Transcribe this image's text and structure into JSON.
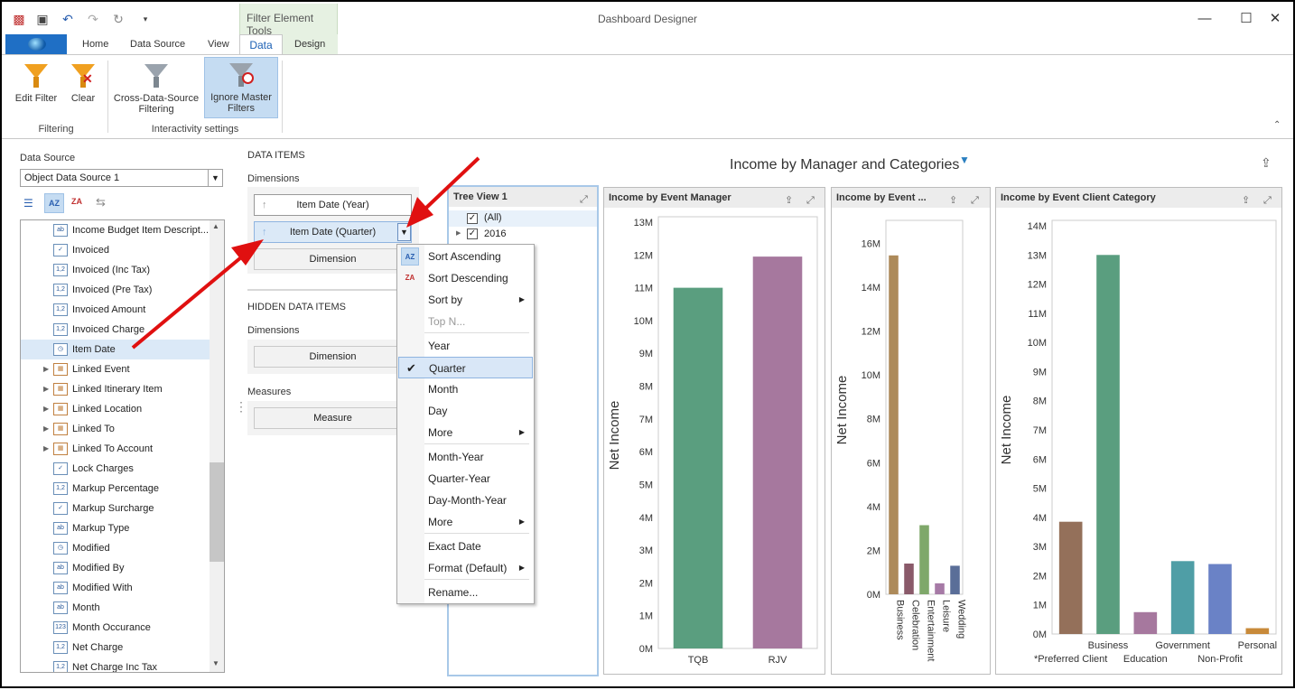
{
  "window": {
    "title": "Dashboard Designer",
    "context_tab_group": "Filter Element Tools"
  },
  "tabs": [
    "Home",
    "Data Source",
    "View",
    "Data",
    "Design"
  ],
  "ribbon": {
    "filtering": {
      "edit_filter": "Edit Filter",
      "clear": "Clear",
      "group": "Filtering"
    },
    "interactivity": {
      "cross_line1": "Cross-Data-Source",
      "cross_line2": "Filtering",
      "ignore_line1": "Ignore Master",
      "ignore_line2": "Filters",
      "group": "Interactivity settings"
    }
  },
  "data_source": {
    "label": "Data Source",
    "value": "Object Data Source 1"
  },
  "fields": [
    {
      "label": "Income Budget Item Descript...",
      "icon": "ab"
    },
    {
      "label": "Invoiced",
      "icon": "check"
    },
    {
      "label": "Invoiced (Inc Tax)",
      "icon": "1,2"
    },
    {
      "label": "Invoiced (Pre Tax)",
      "icon": "1,2"
    },
    {
      "label": "Invoiced Amount",
      "icon": "1,2"
    },
    {
      "label": "Invoiced Charge",
      "icon": "1,2"
    },
    {
      "label": "Item Date",
      "icon": "clock"
    },
    {
      "label": "Linked Event",
      "icon": "table"
    },
    {
      "label": "Linked Itinerary Item",
      "icon": "table"
    },
    {
      "label": "Linked Location",
      "icon": "table"
    },
    {
      "label": "Linked To",
      "icon": "table"
    },
    {
      "label": "Linked To Account",
      "icon": "table"
    },
    {
      "label": "Lock Charges",
      "icon": "check"
    },
    {
      "label": "Markup Percentage",
      "icon": "1,2"
    },
    {
      "label": "Markup Surcharge",
      "icon": "check"
    },
    {
      "label": "Markup Type",
      "icon": "ab"
    },
    {
      "label": "Modified",
      "icon": "clock"
    },
    {
      "label": "Modified By",
      "icon": "ab"
    },
    {
      "label": "Modified With",
      "icon": "ab"
    },
    {
      "label": "Month",
      "icon": "ab"
    },
    {
      "label": "Month Occurance",
      "icon": "123"
    },
    {
      "label": "Net Charge",
      "icon": "1,2"
    },
    {
      "label": "Net Charge Inc Tax",
      "icon": "1,2"
    }
  ],
  "data_items": {
    "header": "DATA ITEMS",
    "dimensions_label": "Dimensions",
    "dim1": "Item Date (Year)",
    "dim2": "Item Date (Quarter)",
    "dim_placeholder": "Dimension",
    "hidden_header": "HIDDEN DATA ITEMS",
    "hidden_dimensions_label": "Dimensions",
    "hidden_dim_placeholder": "Dimension",
    "measures_label": "Measures",
    "measure_placeholder": "Measure"
  },
  "context_menu": [
    {
      "label": "Sort Ascending"
    },
    {
      "label": "Sort Descending"
    },
    {
      "label": "Sort by",
      "sub": true
    },
    {
      "label": "Top N...",
      "disabled": true
    },
    {
      "label": "Year"
    },
    {
      "label": "Quarter",
      "checked": true
    },
    {
      "label": "Month"
    },
    {
      "label": "Day"
    },
    {
      "label": "More",
      "sub": true
    },
    {
      "label": "Month-Year"
    },
    {
      "label": "Quarter-Year"
    },
    {
      "label": "Day-Month-Year"
    },
    {
      "label": "More",
      "sub": true
    },
    {
      "label": "Exact Date"
    },
    {
      "label": "Format (Default)",
      "sub": true
    },
    {
      "label": "Rename..."
    }
  ],
  "dashboard": {
    "title": "Income by Manager and Categories"
  },
  "tree_view": {
    "title": "Tree View 1",
    "items": [
      "(All)",
      "2016"
    ]
  },
  "chart_data": [
    {
      "type": "bar",
      "title": "Income by Event Manager",
      "ylabel": "Net Income",
      "categories": [
        "TQB",
        "RJV"
      ],
      "values": [
        11000000,
        11950000
      ],
      "ylim": [
        0,
        13000000
      ],
      "ticks": [
        "0M",
        "1M",
        "2M",
        "3M",
        "4M",
        "5M",
        "6M",
        "7M",
        "8M",
        "9M",
        "10M",
        "11M",
        "12M",
        "13M"
      ],
      "colors": [
        "#5a9e7f",
        "#a6789e"
      ]
    },
    {
      "type": "bar",
      "title": "Income by Event ...",
      "ylabel": "Net Income",
      "categories": [
        "Business",
        "Celebration",
        "Entertainment",
        "Leisure",
        "Wedding"
      ],
      "values": [
        15450000,
        1400000,
        3150000,
        500000,
        1300000
      ],
      "ylim": [
        0,
        16800000
      ],
      "ticks": [
        "0M",
        "2M",
        "4M",
        "6M",
        "8M",
        "10M",
        "12M",
        "14M",
        "16M"
      ],
      "colors": [
        "#ad8a5a",
        "#8a5a6a",
        "#7fa86a",
        "#a67aa6",
        "#5a6e98"
      ]
    },
    {
      "type": "bar",
      "title": "Income by Event Client Category",
      "ylabel": "Net Income",
      "categories": [
        "*Preferred Client",
        "Business",
        "Education",
        "Government",
        "Non-Profit",
        "Personal"
      ],
      "values": [
        3850000,
        13000000,
        750000,
        2500000,
        2400000,
        200000
      ],
      "ylim": [
        0,
        14000000
      ],
      "ticks": [
        "0M",
        "1M",
        "2M",
        "3M",
        "4M",
        "5M",
        "6M",
        "7M",
        "8M",
        "9M",
        "10M",
        "11M",
        "12M",
        "13M",
        "14M"
      ],
      "colors": [
        "#94705a",
        "#5a9e7f",
        "#a6789e",
        "#4f9ea6",
        "#6a82c6",
        "#c88a3a"
      ]
    }
  ]
}
